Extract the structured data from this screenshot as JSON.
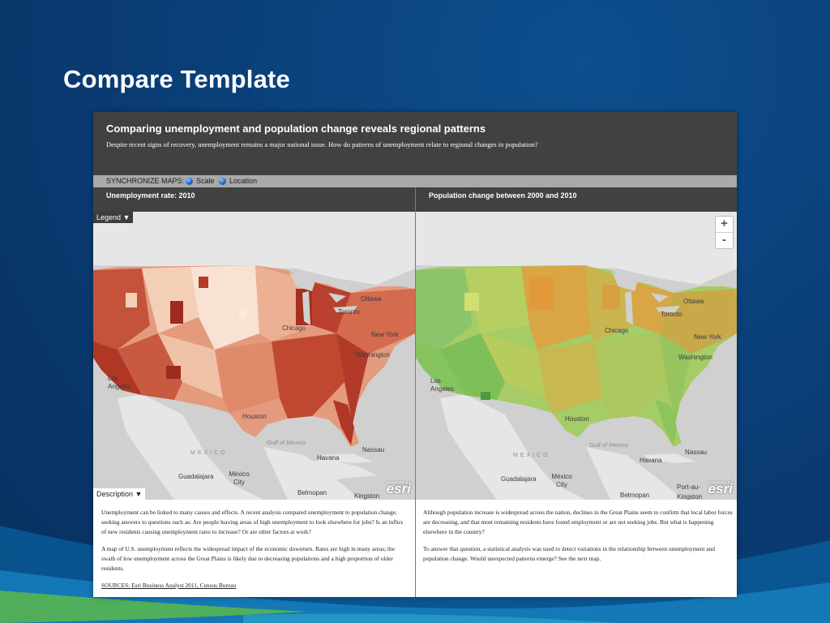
{
  "slide": {
    "title": "Compare Template"
  },
  "app": {
    "title": "Comparing unemployment and population change reveals regional patterns",
    "subtitle": "Despite recent signs of recovery, unemployment remains a major national issue. How do patterns of unemployment relate to regional changes in population?",
    "sync": {
      "label": "SYNCHRONIZE MAPS:",
      "scale": "Scale",
      "location": "Location"
    }
  },
  "left": {
    "heading": "Unemployment rate: 2010",
    "legend_button": "Legend ▼",
    "description_button": "Description ▼",
    "description": [
      "Unemployment can be linked to many causes and effects. A recent analysis compared unemployment to population change, seeking answers to questions such as: Are people leaving areas of high unemployment to look elsewhere for jobs? Is an influx of new residents causing unemployment rates to increase? Or are other factors at work?",
      "A map of U.S. unemployment reflects the widespread impact of the economic downturn. Rates are high in many areas; the swath of low unemployment across the Great Plains is likely due to decreasing populations and a high proportion of older residents."
    ],
    "source": "SOURCES: Esri Business Analyst 2011, Census Bureau"
  },
  "right": {
    "heading": "Population change between 2000 and 2010",
    "zoom_in": "+",
    "zoom_out": "-",
    "description": [
      "Although population increase is widespread across the nation, declines in the Great Plains seem to confirm that local labor forces are decreasing, and that most remaining residents have found employment or are not seeking jobs. But what is happening elsewhere in the country?",
      "To answer that question, a statistical analysis was used to detect variations in the relationship between unemployment and population change. Would unexpected patterns emerge? See the next map."
    ]
  },
  "map_labels": {
    "ottawa": "Ottawa",
    "toronto": "Toronto",
    "chicago": "Chicago",
    "new_york": "New York",
    "washington": "Washington",
    "los_angeles": "Los Angeles",
    "houston": "Houston",
    "gulf": "Gulf of Mexico",
    "mexico": "MEXICO",
    "nassau": "Nassau",
    "havana": "Havana",
    "guadalajara": "Guadalajara",
    "mexico_city": "México City",
    "belmopan": "Belmopan",
    "kingston": "Kingston",
    "port_au": "Port-au-"
  },
  "branding": {
    "powered_by": "POWERED BY",
    "esri": "esri"
  },
  "colors": {
    "unemployment_low": "#f6dcc8",
    "unemployment_high": "#a8301f",
    "population_decline": "#d9a23c",
    "population_growth": "#8cc56a"
  }
}
